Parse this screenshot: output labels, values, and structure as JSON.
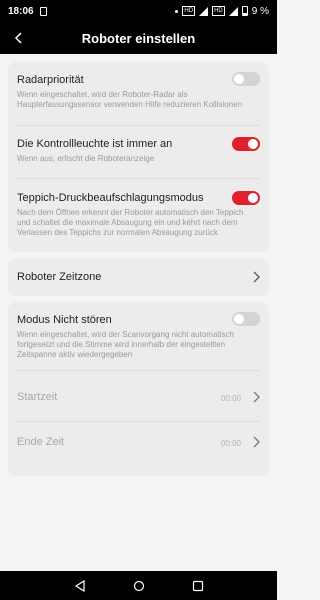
{
  "status_bar": {
    "time": "18:06",
    "network_badge_1": "HD",
    "network_badge_2": "HD",
    "battery": "9 %"
  },
  "header": {
    "title": "Roboter einstellen"
  },
  "settings": {
    "radar": {
      "title": "Radarpriorität",
      "description": "Wenn eingeschaltet, wird der Roboter-Radar als Haupterfassungssensor verwenden Hilfe reduzieren Kollisionen",
      "enabled": false
    },
    "indicator_light": {
      "title": "Die Kontrollleuchte ist immer an",
      "description": "Wenn aus, erlischt die Roboteranzeige",
      "enabled": true
    },
    "carpet_boost": {
      "title": "Teppich-Druckbeaufschlagungsmodus",
      "description": "Nach dem Öffnen erkennt der Roboter automatisch den Teppich und schaltet die maximale Absaugung ein und kehrt nach dem Verlassen des Teppichs zur normalen Absaugung zurück",
      "enabled": true
    },
    "timezone": {
      "title": "Roboter Zeitzone"
    },
    "dnd": {
      "title": "Modus Nicht stören",
      "description": "Wenn eingeschaltet, wird der Scanvorgang nicht automatisch fortgesetzt und die Stimme wird innerhalb der eingestellten Zeitspanne aktiv wiedergegeben",
      "enabled": false,
      "start_label": "Startzeit",
      "start_value": "00:00",
      "end_label": "Ende Zeit",
      "end_value": "00:00"
    }
  },
  "colors": {
    "accent": "#e0202d",
    "toggle_off": "#d4d4d4",
    "card_bg": "#ececec",
    "page_bg": "#f4f4f4"
  }
}
